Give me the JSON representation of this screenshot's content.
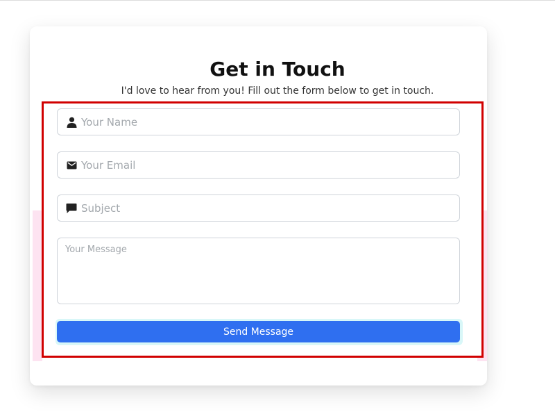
{
  "contact_form": {
    "title": "Get in Touch",
    "subtitle": "I'd love to hear from you! Fill out the form below to get in touch.",
    "fields": {
      "name": {
        "placeholder": "Your Name",
        "value": "",
        "icon": "user-icon"
      },
      "email": {
        "placeholder": "Your Email",
        "value": "",
        "icon": "envelope-icon"
      },
      "subject": {
        "placeholder": "Subject",
        "value": "",
        "icon": "speech-bubble-icon"
      },
      "message": {
        "placeholder": "Your Message",
        "value": ""
      }
    },
    "submit_label": "Send Message"
  },
  "colors": {
    "primary": "#2f6ff0",
    "highlight_border": "#d10000",
    "field_border": "#cfd4da",
    "placeholder": "#a3a8ad"
  }
}
